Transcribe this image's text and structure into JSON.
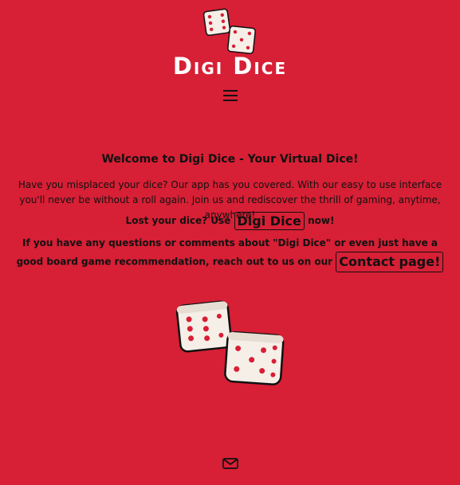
{
  "brand": {
    "name": "Digi Dice",
    "logo_icon": "dice-pair-icon"
  },
  "nav": {
    "menu_icon": "hamburger-menu-icon"
  },
  "main": {
    "heading": "Welcome to Digi Dice - Your Virtual Dice!",
    "intro": "Have you misplaced your dice? Our app has you covered. With our easy to use interface you'll never be without a roll again. Join us and rediscover the thrill of gaming, anytime, anywhere!",
    "lost_prefix": "Lost your dice? Use",
    "dice_button": "Digi Dice",
    "lost_suffix": "now!",
    "contact_prefix": "If you have any questions or comments about \"Digi Dice\" or even just have a good board game recommendation, reach out to us on our",
    "contact_button": "Contact page!"
  },
  "footer": {
    "mail_icon": "envelope-icon"
  },
  "colors": {
    "background": "#d71f35",
    "dice_face": "#f5efe8",
    "pip": "#d71f35",
    "outline": "#111111"
  }
}
